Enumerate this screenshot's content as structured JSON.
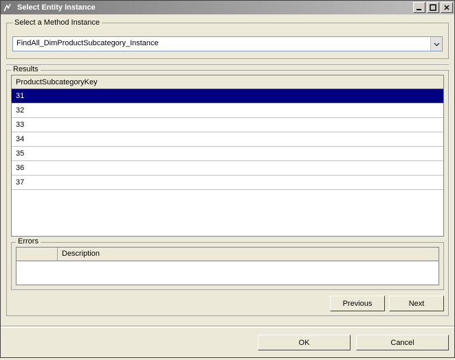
{
  "window": {
    "title": "Select Entity Instance"
  },
  "method": {
    "legend": "Select a Method Instance",
    "selected": "FindAll_DimProductSubcategory_Instance"
  },
  "results": {
    "label": "Results",
    "column_header": "ProductSubcategoryKey",
    "rows": [
      "31",
      "32",
      "33",
      "34",
      "35",
      "36",
      "37"
    ],
    "selected_index": 0
  },
  "errors": {
    "label": "Errors",
    "description_header": "Description"
  },
  "buttons": {
    "previous": "Previous",
    "next": "Next",
    "ok": "OK",
    "cancel": "Cancel"
  }
}
